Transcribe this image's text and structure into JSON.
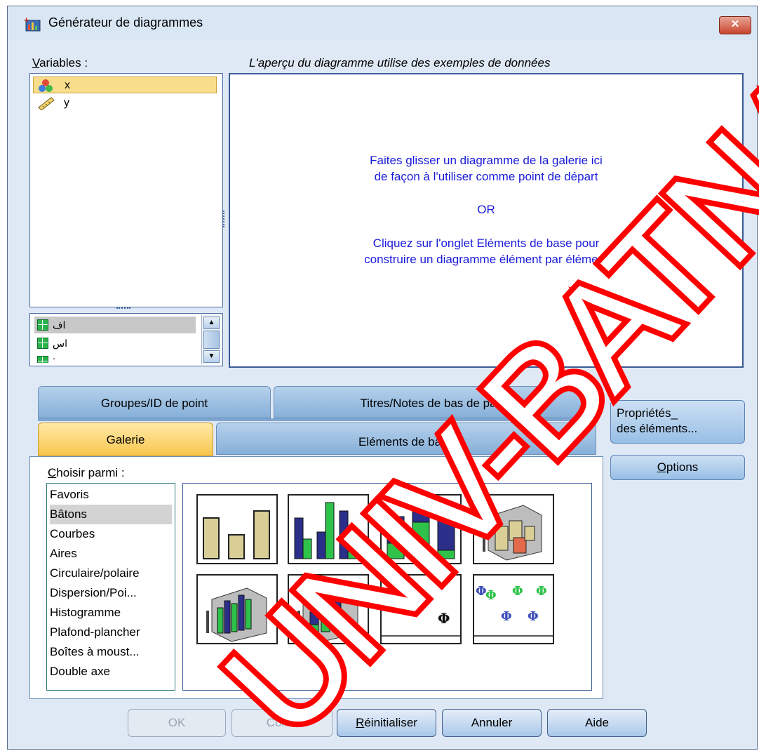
{
  "window": {
    "title": "Générateur de diagrammes",
    "close_label": "✕"
  },
  "variables": {
    "label_u": "V",
    "label_rest": "ariables :",
    "items": [
      {
        "name": "x",
        "icon": "nominal-variable-icon",
        "selected": true
      },
      {
        "name": "y",
        "icon": "scale-ruler-icon",
        "selected": false
      }
    ],
    "sub_items": [
      "اف",
      "اس",
      "."
    ]
  },
  "preview": {
    "caption": "L'aperçu du diagramme utilise des exemples de données",
    "line1": "Faites glisser un diagramme de la galerie ici",
    "line2": "de façon à l'utiliser comme point de départ",
    "or": "OR",
    "line3": "Cliquez sur l'onglet Eléments de base pour",
    "line4": "construire un diagramme élément par élément"
  },
  "tabs": {
    "groups": "Groupes/ID de point",
    "titles": "Titres/Notes de bas de page",
    "gallery": "Galerie",
    "basic": "Eléments de base"
  },
  "side_buttons": {
    "properties_line1": "Propriétés_",
    "properties_line2": "des éléments...",
    "options_u": "O",
    "options_rest": "ptions"
  },
  "choose": {
    "label_u": "C",
    "label_rest": "hoisir parmi :",
    "items": [
      "Favoris",
      "Bâtons",
      "Courbes",
      "Aires",
      "Circulaire/polaire",
      "Dispersion/Poi...",
      "Histogramme",
      "Plafond-plancher",
      "Boîtes à moust...",
      "Double axe"
    ],
    "selected_index": 1
  },
  "buttons": {
    "ok": "OK",
    "paste": "Coller",
    "reset_u": "R",
    "reset_rest": "éinitialiser",
    "cancel": "Annuler",
    "help": "Aide"
  },
  "watermark": "UNIV-BATNA",
  "colors": {
    "accent_blue": "#1a1adb",
    "tab_active": "#f8c64e",
    "watermark_red": "#ff0000",
    "bar_tan": "#d9cf96",
    "bar_navy": "#2b2f8a",
    "bar_green": "#2ec24a"
  }
}
